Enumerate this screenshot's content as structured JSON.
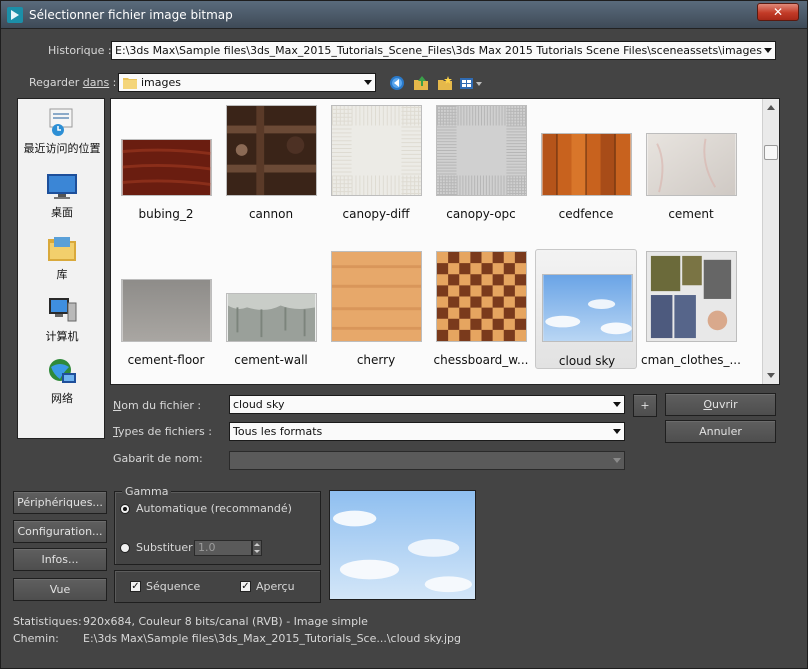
{
  "window": {
    "title": "Sélectionner fichier image bitmap",
    "close_label": "✕"
  },
  "history": {
    "label": "Historique :",
    "value": "E:\\3ds Max\\Sample files\\3ds_Max_2015_Tutorials_Scene_Files\\3ds Max 2015 Tutorials Scene Files\\sceneassets\\images"
  },
  "look_in": {
    "label_prefix": "Regarder ",
    "label_underlined": "dans",
    "label_suffix": " :",
    "value": "images"
  },
  "toolbar": {
    "back_icon": "back-arrow-icon",
    "up_icon": "up-folder-icon",
    "new_folder_icon": "new-folder-icon",
    "view_menu_icon": "view-menu-icon"
  },
  "places": [
    {
      "label": "最近访问的位置",
      "icon": "recent-places-icon"
    },
    {
      "label": "桌面",
      "icon": "desktop-icon"
    },
    {
      "label": "库",
      "icon": "libraries-icon"
    },
    {
      "label": "计算机",
      "icon": "computer-icon"
    },
    {
      "label": "网络",
      "icon": "network-icon"
    }
  ],
  "files": [
    {
      "name": "bubing_2"
    },
    {
      "name": "cannon"
    },
    {
      "name": "canopy-diff"
    },
    {
      "name": "canopy-opc"
    },
    {
      "name": "cedfence"
    },
    {
      "name": "cement"
    },
    {
      "name": "cement-floor"
    },
    {
      "name": "cement-wall"
    },
    {
      "name": "cherry"
    },
    {
      "name": "chessboard_w..."
    },
    {
      "name": "cloud sky"
    },
    {
      "name": "cman_clothes_..."
    }
  ],
  "selected_file": "cloud sky",
  "filename": {
    "label_underlined": "N",
    "label_rest": "om du fichier :",
    "value": "cloud sky",
    "plus_label": "+"
  },
  "filetypes": {
    "label_underlined": "T",
    "label_rest": "ypes de fichiers :",
    "value": "Tous les formats"
  },
  "pattern": {
    "label": "Gabarit de nom:",
    "value": ""
  },
  "buttons": {
    "open_underlined": "O",
    "open_rest": "uvrir",
    "cancel": "Annuler",
    "devices": "Périphériques...",
    "setup": "Configuration...",
    "info": "Infos...",
    "view": "Vue"
  },
  "gamma": {
    "title": "Gamma",
    "automatic": "Automatique (recommandé)",
    "override": "Substituer",
    "override_value": "1.0",
    "selected": "automatic"
  },
  "options": {
    "sequence": "Séquence",
    "sequence_checked": true,
    "preview": "Aperçu",
    "preview_checked": true
  },
  "status": {
    "stats_label": "Statistiques:",
    "stats_value": "920x684, Couleur 8 bits/canal (RVB) - Image simple",
    "path_label": "Chemin:",
    "path_value": "E:\\3ds Max\\Sample files\\3ds_Max_2015_Tutorials_Sce...\\cloud sky.jpg"
  },
  "colors": {
    "dialog_bg": "#444444",
    "list_bg": "#fbfbfb",
    "accent_close": "#c33b28"
  }
}
